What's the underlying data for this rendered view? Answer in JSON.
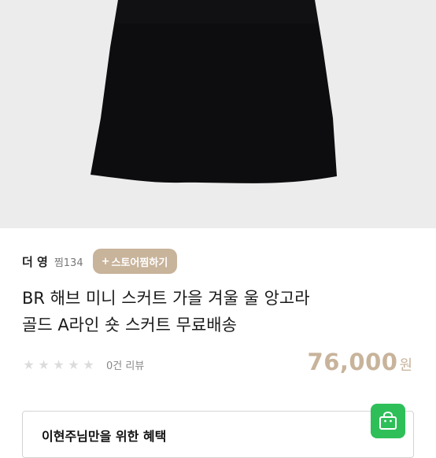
{
  "product_image": {
    "description_icon": "black-skirt-photo"
  },
  "seller": {
    "name": "더 영",
    "likes_label": "찜134",
    "store_like_button": {
      "plus": "+",
      "label": "스토어찜하기"
    }
  },
  "product": {
    "title_line1": "BR 해브 미니 스커트 가을 겨울 울 앙고라",
    "title_line2": "골드 A라인 숏 스커트 무료배송",
    "rating": 0,
    "rating_max": 5,
    "review_count_label": "0건 리뷰",
    "price_value": "76,000",
    "price_unit": "원"
  },
  "benefit": {
    "title": "이현주님만을 위한 혜택",
    "icon": "shopping-bag-icon"
  },
  "colors": {
    "accent": "#c8b39b",
    "green": "#2fbf59",
    "star_empty": "#dcdcdc"
  }
}
